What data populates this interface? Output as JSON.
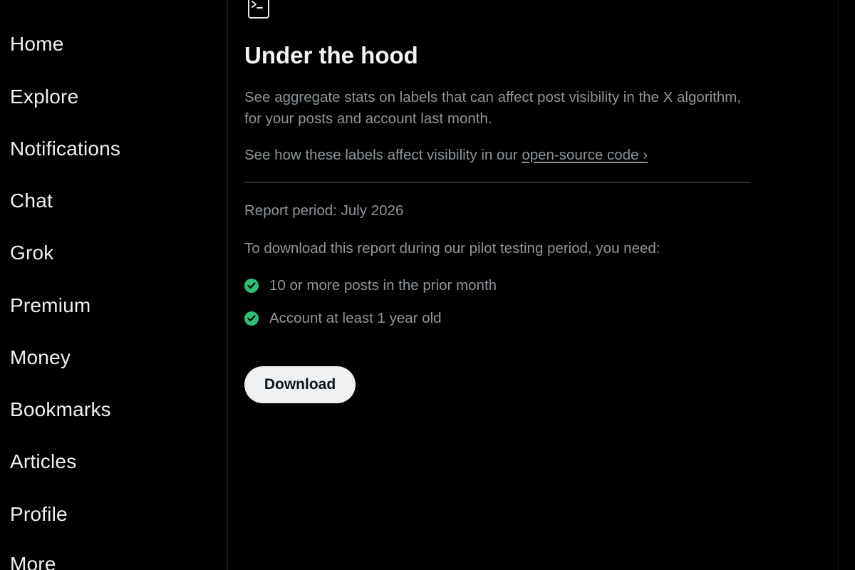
{
  "sidebar": {
    "items": [
      {
        "label": "Home"
      },
      {
        "label": "Explore"
      },
      {
        "label": "Notifications"
      },
      {
        "label": "Chat"
      },
      {
        "label": "Grok"
      },
      {
        "label": "Premium"
      },
      {
        "label": "Money"
      },
      {
        "label": "Bookmarks"
      },
      {
        "label": "Articles"
      },
      {
        "label": "Profile"
      },
      {
        "label": "More"
      }
    ]
  },
  "main": {
    "header_icon": "terminal-icon",
    "title": "Under the hood",
    "description": "See aggregate stats on labels that can affect post visibility in the X algorithm, for your posts and account last month.",
    "oss_prefix": "See how these labels affect visibility in our ",
    "oss_link": "open-source code ›",
    "report_period": "Report period: July 2026",
    "requirements_intro": "To download this report during our pilot testing period, you need:",
    "requirements": [
      {
        "label": "10 or more posts in the prior month",
        "met": true,
        "icon": "check-circle-icon"
      },
      {
        "label": "Account at least 1 year old",
        "met": true,
        "icon": "check-circle-icon"
      }
    ],
    "download_label": "Download"
  },
  "colors": {
    "background": "#000000",
    "primary_text": "#e7e9ea",
    "secondary_text": "#8f959a",
    "check_green": "#2fbe77",
    "button_bg": "#eff0f1",
    "button_text": "#0f1419"
  }
}
